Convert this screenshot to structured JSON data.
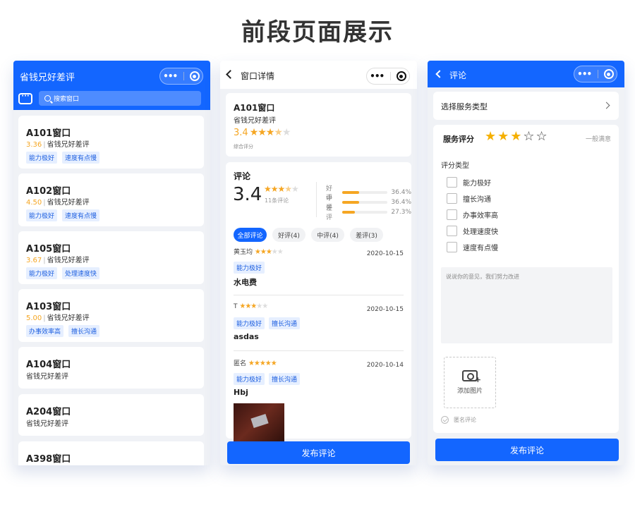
{
  "page_title": "前段页面展示",
  "capsule": {
    "dots": "•••"
  },
  "list_screen": {
    "title": "省钱兄好差评",
    "search_placeholder": "搜索窗口",
    "windows": [
      {
        "name": "A101窗口",
        "score": "3.36",
        "sub": "省钱兄好差评",
        "tags": [
          "能力极好",
          "速度有点慢"
        ]
      },
      {
        "name": "A102窗口",
        "score": "4.50",
        "sub": "省钱兄好差评",
        "tags": [
          "能力极好",
          "速度有点慢"
        ]
      },
      {
        "name": "A105窗口",
        "score": "3.67",
        "sub": "省钱兄好差评",
        "tags": [
          "能力极好",
          "处理速度快"
        ]
      },
      {
        "name": "A103窗口",
        "score": "5.00",
        "sub": "省钱兄好差评",
        "tags": [
          "办事效率高",
          "擅长沟通"
        ]
      },
      {
        "name": "A104窗口",
        "score": "",
        "sub": "省钱兄好差评",
        "tags": []
      },
      {
        "name": "A204窗口",
        "score": "",
        "sub": "省钱兄好差评",
        "tags": []
      },
      {
        "name": "A398窗口",
        "score": "",
        "sub": "",
        "tags": []
      }
    ]
  },
  "detail_screen": {
    "title": "窗口详情",
    "window_name": "A101窗口",
    "window_sub": "省钱兄好差评",
    "score": "3.4",
    "score_caption": "综合评分",
    "reviews_heading": "评论",
    "big_score": "3.4",
    "review_count": "11条评论",
    "ratios": [
      {
        "label": "好评",
        "value": "36.4%",
        "fraction": 0.364
      },
      {
        "label": "中评",
        "value": "36.4%",
        "fraction": 0.364
      },
      {
        "label": "差评",
        "value": "27.3%",
        "fraction": 0.273
      }
    ],
    "filters": [
      "全部评论",
      "好评(4)",
      "中评(4)",
      "差评(3)"
    ],
    "reviews": [
      {
        "user": "黄玉均",
        "stars": 3,
        "date": "2020-10-15",
        "tags": [
          "能力极好"
        ],
        "text": "水电费"
      },
      {
        "user": "T",
        "stars": 3,
        "date": "2020-10-15",
        "tags": [
          "能力极好",
          "擅长沟通"
        ],
        "text": "asdas"
      },
      {
        "user": "匿名",
        "stars": 5,
        "date": "2020-10-14",
        "tags": [
          "能力极好",
          "擅长沟通"
        ],
        "text": "Hbj"
      }
    ],
    "submit": "发布评论"
  },
  "comment_screen": {
    "title": "评论",
    "select_service": "选择服务类型",
    "service_rating_label": "服务评分",
    "rating": 3,
    "rating_text": "一般满意",
    "category_heading": "评分类型",
    "categories": [
      "能力极好",
      "擅长沟通",
      "办事效率高",
      "处理速度快",
      "速度有点慢"
    ],
    "textarea_placeholder": "说说你的意见，我们努力改进",
    "add_photo": "添加图片",
    "anonymous": "匿名评论",
    "submit": "发布评论"
  }
}
